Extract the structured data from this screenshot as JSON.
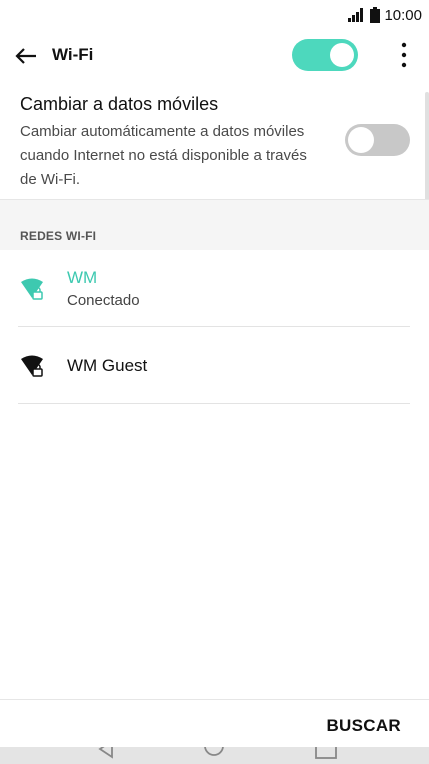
{
  "status_bar": {
    "time": "10:00",
    "signal_icon": "signal-bars-icon",
    "battery_icon": "battery-icon"
  },
  "app_bar": {
    "title": "Wi-Fi",
    "back_icon": "arrow-left-icon",
    "more_icon": "more-vertical-icon",
    "wifi_toggle_on": true,
    "accent_color": "#4dd8bd"
  },
  "mobile_data_setting": {
    "title": "Cambiar a datos móviles",
    "description": "Cambiar automáticamente a datos móviles cuando Internet no está disponible a través de Wi-Fi.",
    "toggle_on": false
  },
  "section": {
    "label": "REDES WI-FI"
  },
  "networks": [
    {
      "name": "WM",
      "status": "Conectado",
      "connected": true,
      "icon": "wifi-locked-icon",
      "color": "#3dc9b0"
    },
    {
      "name": "WM Guest",
      "connected": false,
      "icon": "wifi-locked-icon",
      "color": "#111111"
    }
  ],
  "bottom": {
    "search_label": "BUSCAR"
  },
  "nav_bar": {
    "icons": [
      "back-triangle-icon",
      "home-circle-icon",
      "recents-square-icon"
    ]
  }
}
